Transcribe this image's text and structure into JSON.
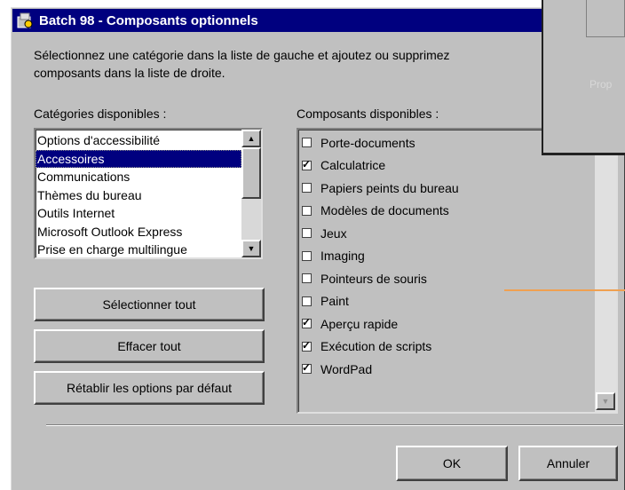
{
  "window": {
    "title": "Batch 98 - Composants optionnels",
    "icon": "batch-app-icon"
  },
  "instructions": {
    "line1": "Sélectionnez une catégorie dans la liste de gauche et ajoutez ou supprimez",
    "line2": "composants dans la liste de droite."
  },
  "categories": {
    "label": "Catégories disponibles :",
    "items": [
      "Options d'accessibilité",
      "Accessoires",
      "Communications",
      "Thèmes du bureau",
      "Outils Internet",
      "Microsoft Outlook Express",
      "Prise en charge multilingue"
    ],
    "selected": "Accessoires"
  },
  "components": {
    "label": "Composants disponibles :",
    "items": [
      {
        "label": "Porte-documents",
        "checked": false
      },
      {
        "label": "Calculatrice",
        "checked": true
      },
      {
        "label": "Papiers peints du bureau",
        "checked": false
      },
      {
        "label": "Modèles de documents",
        "checked": false
      },
      {
        "label": "Jeux",
        "checked": false
      },
      {
        "label": "Imaging",
        "checked": false
      },
      {
        "label": "Pointeurs de souris",
        "checked": false
      },
      {
        "label": "Paint",
        "checked": false
      },
      {
        "label": "Aperçu rapide",
        "checked": true
      },
      {
        "label": "Exécution de scripts",
        "checked": true
      },
      {
        "label": "WordPad",
        "checked": true
      }
    ]
  },
  "buttons": {
    "select_all": "Sélectionner tout",
    "clear_all": "Effacer tout",
    "restore_defaults": "Rétablir les options par défaut",
    "ok": "OK",
    "cancel": "Annuler"
  },
  "overlay": {
    "text": "Prop"
  },
  "colors": {
    "titlebar": "#00007f",
    "face": "#c0c0c0",
    "selection": "#00007f",
    "accent_line": "#f0a050"
  }
}
